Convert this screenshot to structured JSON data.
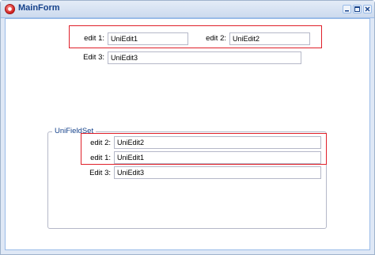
{
  "window": {
    "title": "MainForm",
    "icon": "app-icon",
    "controls": [
      "minimize-icon",
      "maximize-icon",
      "close-icon"
    ]
  },
  "top_fields": {
    "edit1": {
      "label": "edit 1:",
      "value": "UniEdit1"
    },
    "edit2": {
      "label": "edit 2:",
      "value": "UniEdit2"
    },
    "edit3": {
      "label": "Edit 3:",
      "value": "UniEdit3"
    }
  },
  "fieldset": {
    "legend": "UniFieldSet",
    "edit2": {
      "label": "edit 2:",
      "value": "UniEdit2"
    },
    "edit1": {
      "label": "edit 1:",
      "value": "UniEdit1"
    },
    "edit3": {
      "label": "Edit 3:",
      "value": "UniEdit3"
    }
  },
  "colors": {
    "highlight": "#e0202a",
    "title_text": "#15428b",
    "border": "#99bbe8"
  }
}
